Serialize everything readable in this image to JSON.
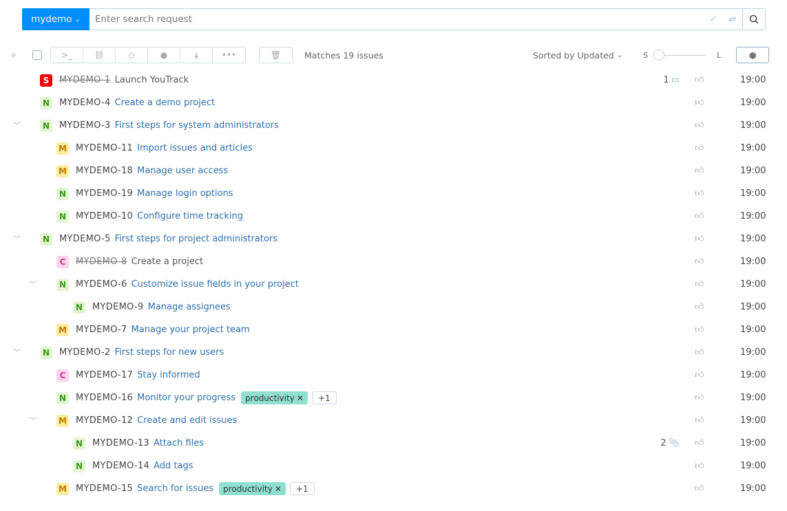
{
  "search": {
    "project": "mydemo",
    "placeholder": "Enter search request"
  },
  "toolbar": {
    "matches": "Matches 19 issues",
    "sort": "Sorted by Updated",
    "size_small": "S",
    "size_large": "L",
    "size_value": 0
  },
  "colors": {
    "accent": "#008eff",
    "link": "#2f6fab",
    "tag": "#8fe0d0"
  },
  "issues": [
    {
      "id": "MYDEMO-1",
      "summary": "Launch YouTrack",
      "priority": "S",
      "level": 0,
      "resolved": true,
      "comments": "1",
      "time": "19:00"
    },
    {
      "id": "MYDEMO-4",
      "summary": "Create a demo project",
      "priority": "N",
      "level": 0,
      "time": "19:00"
    },
    {
      "id": "MYDEMO-3",
      "summary": "First steps for system administrators",
      "priority": "N",
      "level": 0,
      "expanded": true,
      "time": "19:00"
    },
    {
      "id": "MYDEMO-11",
      "summary": "Import issues and articles",
      "priority": "M",
      "level": 1,
      "time": "19:00"
    },
    {
      "id": "MYDEMO-18",
      "summary": "Manage user access",
      "priority": "M",
      "level": 1,
      "time": "19:00"
    },
    {
      "id": "MYDEMO-19",
      "summary": "Manage login options",
      "priority": "N",
      "level": 1,
      "time": "19:00"
    },
    {
      "id": "MYDEMO-10",
      "summary": "Configure time tracking",
      "priority": "N",
      "level": 1,
      "time": "19:00"
    },
    {
      "id": "MYDEMO-5",
      "summary": "First steps for project administrators",
      "priority": "N",
      "level": 0,
      "expanded": true,
      "time": "19:00"
    },
    {
      "id": "MYDEMO-8",
      "summary": "Create a project",
      "priority": "C",
      "level": 1,
      "resolved": true,
      "time": "19:00"
    },
    {
      "id": "MYDEMO-6",
      "summary": "Customize issue fields in your project",
      "priority": "N",
      "level": 1,
      "expanded": true,
      "time": "19:00"
    },
    {
      "id": "MYDEMO-9",
      "summary": "Manage assignees",
      "priority": "N",
      "level": 2,
      "time": "19:00"
    },
    {
      "id": "MYDEMO-7",
      "summary": "Manage your project team",
      "priority": "M",
      "level": 1,
      "time": "19:00"
    },
    {
      "id": "MYDEMO-2",
      "summary": "First steps for new users",
      "priority": "N",
      "level": 0,
      "expanded": true,
      "time": "19:00"
    },
    {
      "id": "MYDEMO-17",
      "summary": "Stay informed",
      "priority": "C",
      "level": 1,
      "time": "19:00"
    },
    {
      "id": "MYDEMO-16",
      "summary": "Monitor your progress",
      "priority": "N",
      "level": 1,
      "tag": "productivity",
      "more": "+1",
      "time": "19:00"
    },
    {
      "id": "MYDEMO-12",
      "summary": "Create and edit issues",
      "priority": "M",
      "level": 1,
      "expanded": true,
      "time": "19:00"
    },
    {
      "id": "MYDEMO-13",
      "summary": "Attach files",
      "priority": "N",
      "level": 2,
      "attachments": "2",
      "time": "19:00"
    },
    {
      "id": "MYDEMO-14",
      "summary": "Add tags",
      "priority": "N",
      "level": 2,
      "time": "19:00"
    },
    {
      "id": "MYDEMO-15",
      "summary": "Search for issues",
      "priority": "M",
      "level": 1,
      "tag": "productivity",
      "more": "+1",
      "time": "19:00"
    }
  ]
}
